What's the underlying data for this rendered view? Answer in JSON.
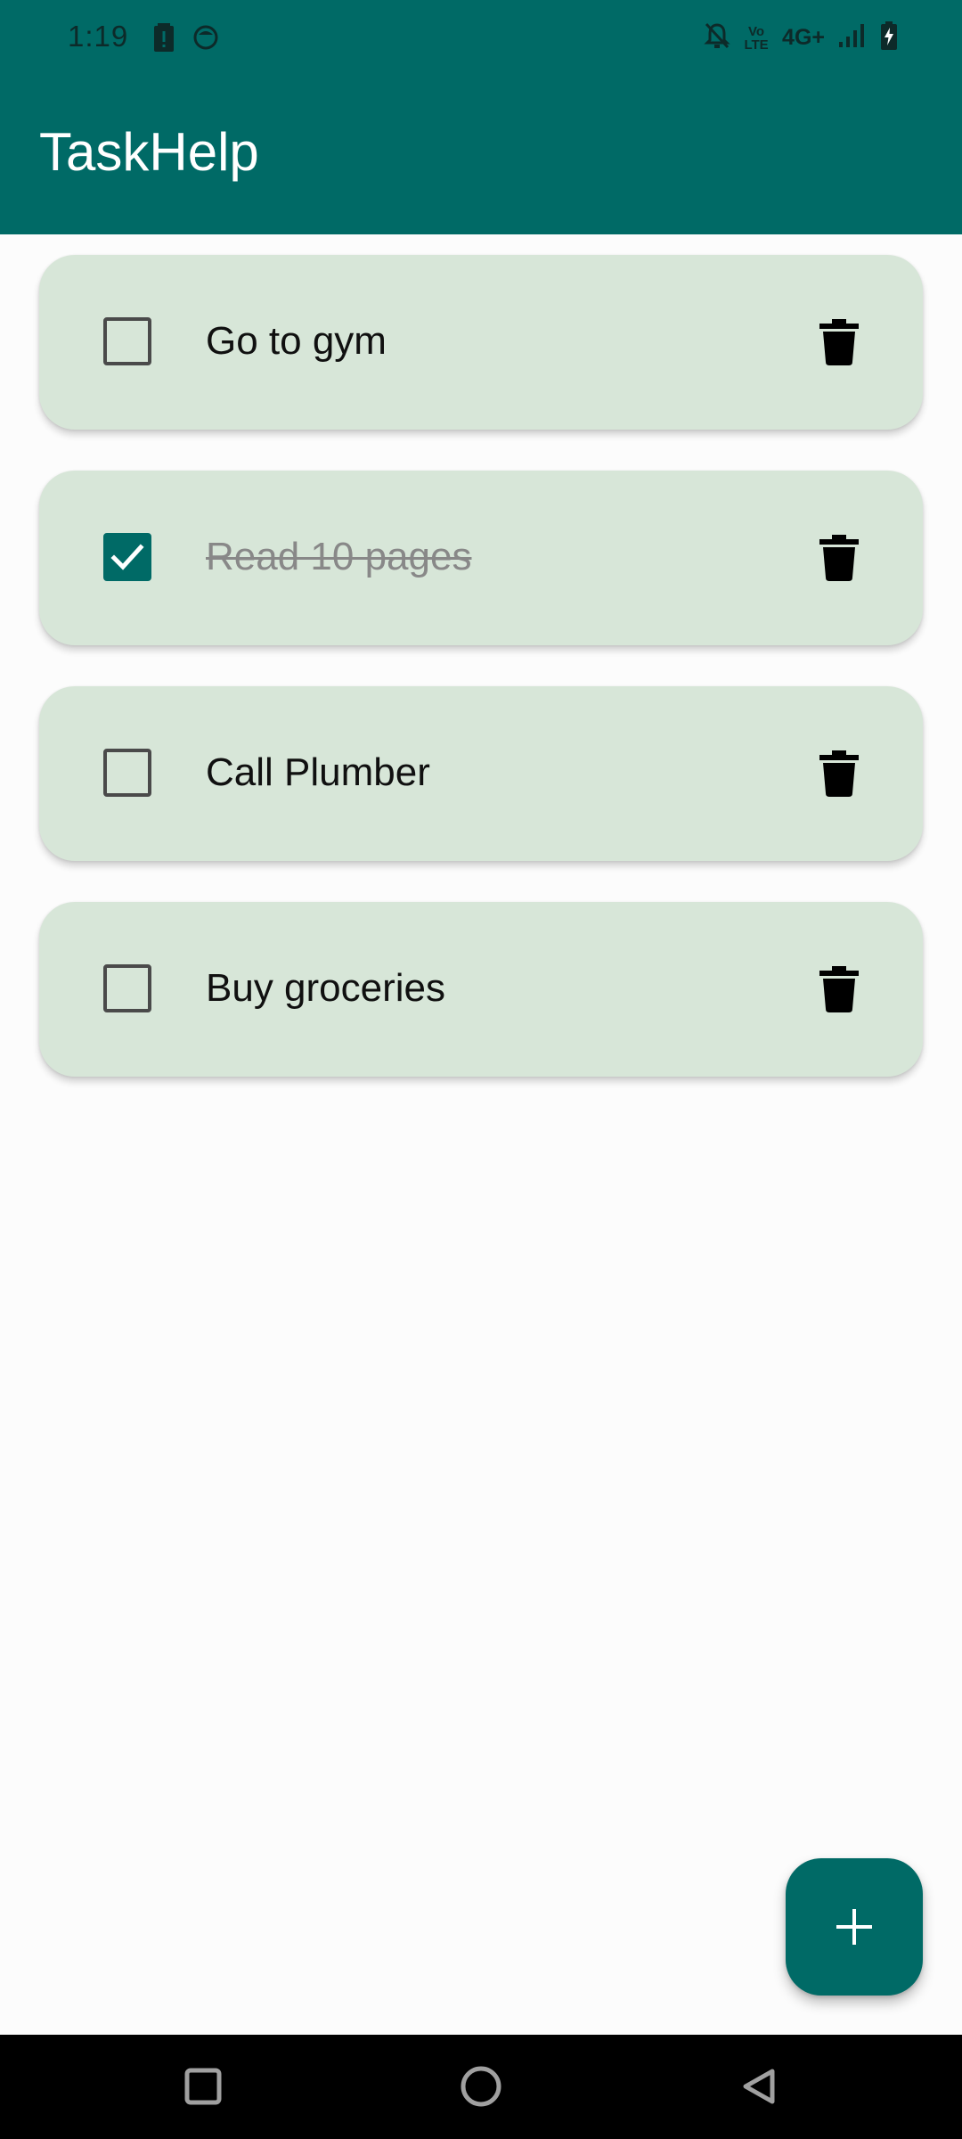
{
  "status_bar": {
    "time": "1:19",
    "network": "4G+",
    "volte": "VoLTE"
  },
  "app_bar": {
    "title": "TaskHelp"
  },
  "tasks": [
    {
      "label": "Go to gym",
      "checked": false
    },
    {
      "label": "Read 10 pages",
      "checked": true
    },
    {
      "label": "Call Plumber",
      "checked": false
    },
    {
      "label": "Buy groceries",
      "checked": false
    }
  ],
  "icons": {
    "delete": "trash-icon",
    "add": "plus-icon",
    "check": "check-icon"
  },
  "colors": {
    "primary": "#006a66",
    "card": "#d7e6d8",
    "background": "#fcfcfc",
    "done_text": "#888888"
  },
  "nav": {
    "recents": "square-icon",
    "home": "circle-icon",
    "back": "triangle-back-icon"
  }
}
